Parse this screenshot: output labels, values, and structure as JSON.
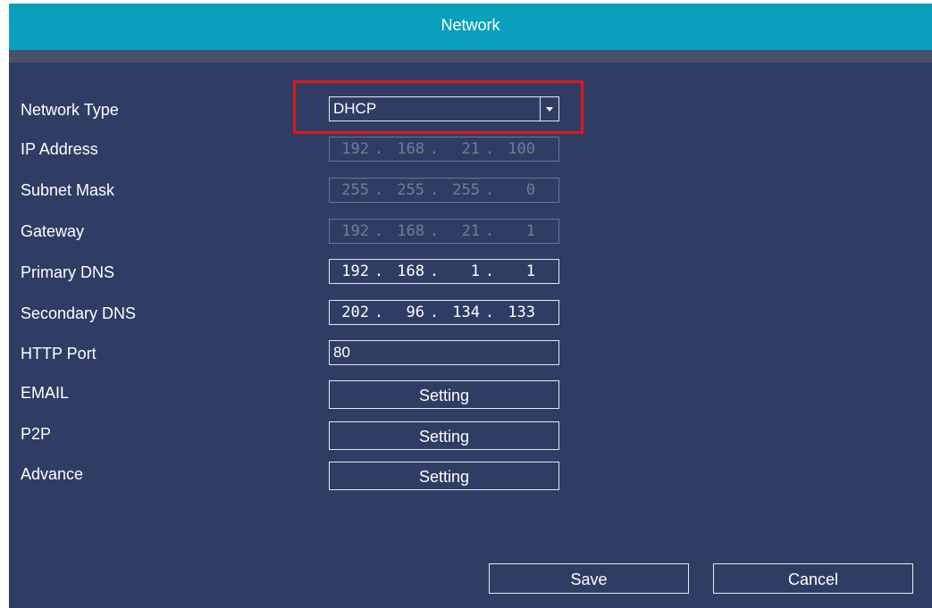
{
  "window": {
    "title": "Network"
  },
  "form": {
    "network_type": {
      "label": "Network Type",
      "value": "DHCP"
    },
    "ip_address": {
      "label": "IP Address",
      "parts": [
        "192",
        "168",
        "21",
        "100"
      ]
    },
    "subnet_mask": {
      "label": "Subnet Mask",
      "parts": [
        "255",
        "255",
        "255",
        "0"
      ]
    },
    "gateway": {
      "label": "Gateway",
      "parts": [
        "192",
        "168",
        "21",
        "1"
      ]
    },
    "primary_dns": {
      "label": "Primary DNS",
      "parts": [
        "192",
        "168",
        "1",
        "1"
      ]
    },
    "secondary_dns": {
      "label": "Secondary DNS",
      "parts": [
        "202",
        "96",
        "134",
        "133"
      ]
    },
    "http_port": {
      "label": "HTTP Port",
      "value": "80"
    },
    "email": {
      "label": "EMAIL",
      "button": "Setting"
    },
    "p2p": {
      "label": "P2P",
      "button": "Setting"
    },
    "advance": {
      "label": "Advance",
      "button": "Setting"
    }
  },
  "footer": {
    "save_label": "Save",
    "cancel_label": "Cancel"
  },
  "colors": {
    "title_bar": "#0aa0bd",
    "panel": "#2f3d64",
    "highlight": "#e0161b"
  },
  "icons": {
    "dropdown": "chevron-down-icon"
  }
}
